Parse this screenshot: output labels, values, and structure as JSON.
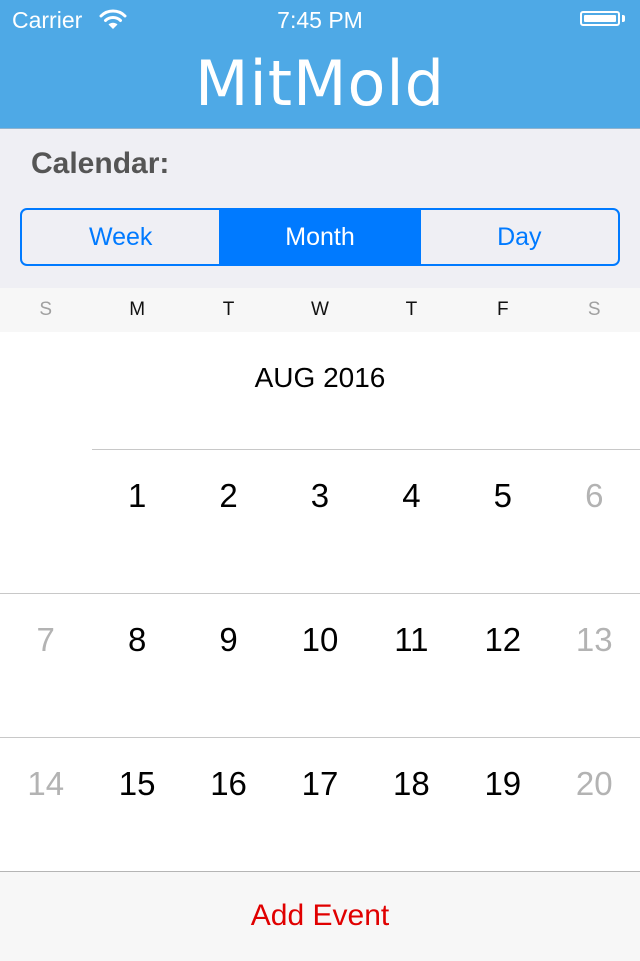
{
  "status_bar": {
    "carrier": "Carrier",
    "time": "7:45 PM",
    "wifi_icon": "wifi-icon",
    "battery_icon": "battery-full-icon",
    "battery_level": 1.0
  },
  "header": {
    "title": "MitMold",
    "background_color": "#4ea9e6"
  },
  "calendar_section": {
    "label": "Calendar:",
    "segments": [
      {
        "label": "Week",
        "selected": false
      },
      {
        "label": "Month",
        "selected": true
      },
      {
        "label": "Day",
        "selected": false
      }
    ],
    "accent_color": "#007aff"
  },
  "calendar": {
    "weekdays": [
      "S",
      "M",
      "T",
      "W",
      "T",
      "F",
      "S"
    ],
    "month_title": "AUG 2016",
    "weeks": [
      [
        "",
        "1",
        "2",
        "3",
        "4",
        "5",
        "6"
      ],
      [
        "7",
        "8",
        "9",
        "10",
        "11",
        "12",
        "13"
      ],
      [
        "14",
        "15",
        "16",
        "17",
        "18",
        "19",
        "20"
      ]
    ]
  },
  "bottom_bar": {
    "add_event_label": "Add Event",
    "color": "#e00000"
  }
}
